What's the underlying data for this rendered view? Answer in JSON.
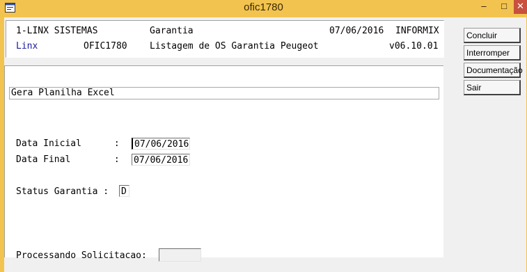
{
  "window": {
    "title": "ofic1780",
    "minimize_glyph": "–",
    "maximize_glyph": "□",
    "close_glyph": "✕",
    "accent": "#f2c34f"
  },
  "header": {
    "company": "1-LINX SISTEMAS",
    "module": "Garantia",
    "date": "07/06/2016",
    "db": "INFORMIX",
    "brand": "Linx",
    "program": "OFIC1780",
    "description": "Listagem de OS Garantia Peugeot",
    "version": "v06.10.01"
  },
  "form": {
    "section_title": "Gera Planilha Excel",
    "data_inicial_label": "Data Inicial      :",
    "data_inicial_value": "07/06/2016",
    "data_final_label": "Data Final        :",
    "data_final_value": "07/06/2016",
    "status_label": "Status Garantia :",
    "status_value": "D",
    "processing_label": "Processando Solicitacao:",
    "processing_value": ""
  },
  "actions": {
    "concluir": "Concluir",
    "interromper": "Interromper",
    "documentacao": "Documentação",
    "sair": "Sair"
  }
}
